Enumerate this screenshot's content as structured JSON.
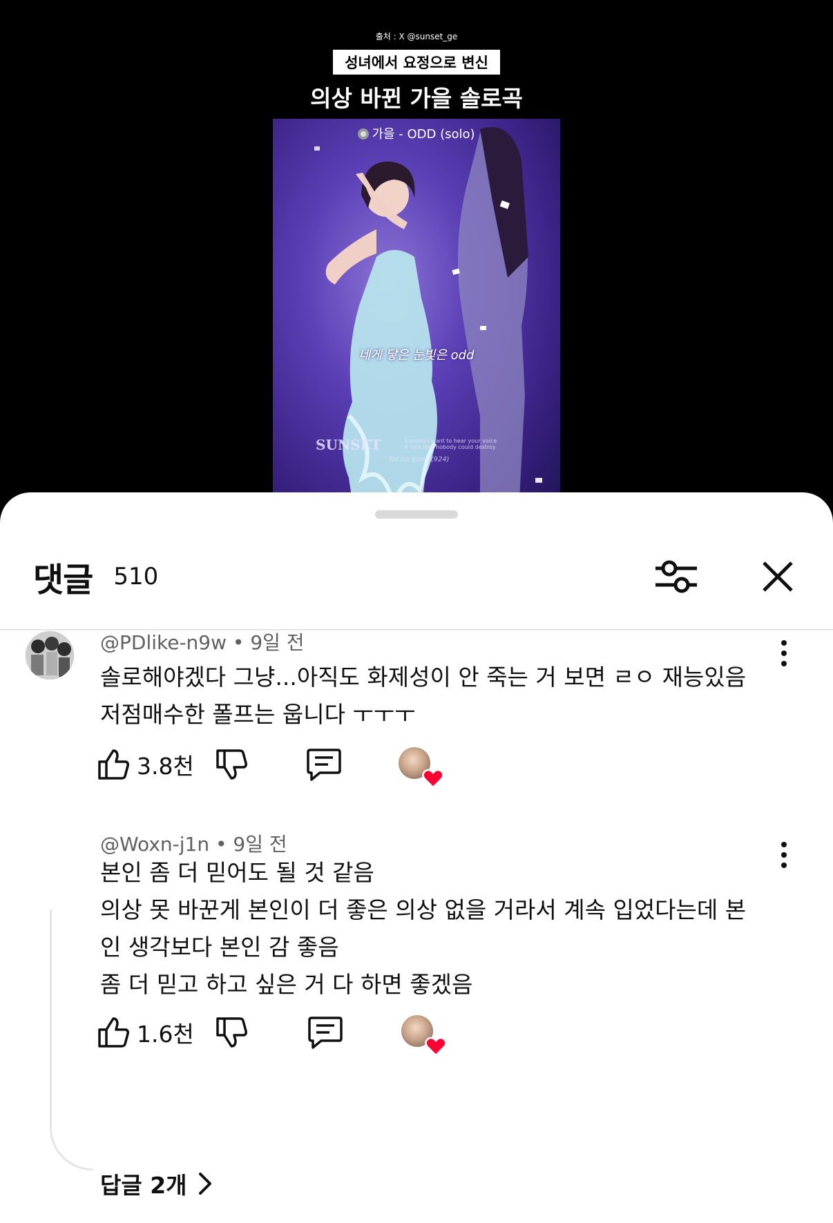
{
  "video": {
    "source": "출처 : X @sunset_ge",
    "subtitle": "성녀에서 요정으로 변신",
    "headline": "의상 바뀐 가을 솔로곡",
    "song": "가을 - ODD (solo)",
    "lyric": "네게 닿은 눈빛은 odd",
    "watermark": "SUNSET",
    "watermark_small_1": "Sunsets I want to hear your voice",
    "watermark_small_2": "A love that nobody could destroy",
    "watermark_sub": "for no good  (924)"
  },
  "sheet": {
    "title": "댓글",
    "count": "510"
  },
  "comments": [
    {
      "author": "@PDlike-n9w",
      "time": "9일 전",
      "meta": "@PDlike-n9w • 9일 전",
      "text": "솔로해야겠다 그냥...아직도 화제성이 안 죽는 거 보면 ㄹㅇ 재능있음\n저점매수한 폴프는 웁니다 ㅜㅜㅜ",
      "likes": "3.8천"
    },
    {
      "author": "@Woxn-j1n",
      "time": "9일 전",
      "meta": "@Woxn-j1n • 9일 전",
      "text": "본인 좀 더 믿어도 될 것 같음\n의상 못 바꾼게 본인이 더 좋은 의상 없을 거라서 계속 입었다는데 본\n인 생각보다 본인 감 좋음\n좀 더 믿고 하고 싶은 거 다 하면 좋겠음",
      "likes": "1.6천"
    }
  ],
  "replies": {
    "label": "답글 2개"
  },
  "colors": {
    "sheet_bg": "#ffffff",
    "text": "#0f0f0f",
    "meta": "#606060",
    "heart": "#ff0033",
    "stage_purple": "#5a3fb5"
  },
  "icons": [
    "filter-icon",
    "close-icon",
    "more-vert-icon",
    "thumb-up-icon",
    "thumb-down-icon",
    "reply-icon",
    "creator-heart-icon",
    "chevron-right-icon",
    "disc-icon"
  ]
}
